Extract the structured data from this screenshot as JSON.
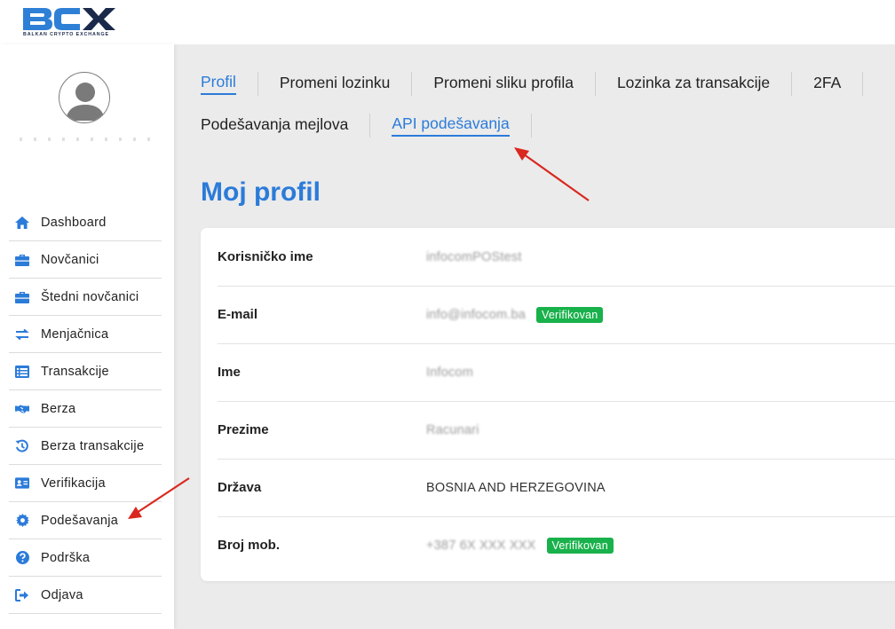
{
  "logo": {
    "text": "BCX",
    "tagline": "BALKAN CRYPTO EXCHANGE"
  },
  "colors": {
    "accent": "#2b7bd9",
    "verified": "#19b14b",
    "annotation": "#d9281f"
  },
  "sidebar": {
    "items": [
      {
        "label": "Dashboard",
        "icon": "home-icon"
      },
      {
        "label": "Novčanici",
        "icon": "briefcase-icon"
      },
      {
        "label": "Štedni novčanici",
        "icon": "briefcase-icon"
      },
      {
        "label": "Menjačnica",
        "icon": "exchange-icon"
      },
      {
        "label": "Transakcije",
        "icon": "list-icon"
      },
      {
        "label": "Berza",
        "icon": "handshake-icon"
      },
      {
        "label": "Berza transakcije",
        "icon": "history-icon"
      },
      {
        "label": "Verifikacija",
        "icon": "id-card-icon"
      },
      {
        "label": "Podešavanja",
        "icon": "gear-icon"
      },
      {
        "label": "Podrška",
        "icon": "question-icon"
      },
      {
        "label": "Odjava",
        "icon": "sign-out-icon"
      }
    ]
  },
  "tabs": {
    "profil": "Profil",
    "promeni_lozinku": "Promeni lozinku",
    "promeni_sliku": "Promeni sliku profila",
    "lozinka_transakcije": "Lozinka za transakcije",
    "twofa": "2FA",
    "podesavanja_mejlova": "Podešavanja mejlova",
    "api_podesavanja": "API podešavanja"
  },
  "page_title": "Moj profil",
  "profile": {
    "korisnicko_ime": {
      "label": "Korisničko ime",
      "value": "infocomPOStest"
    },
    "email": {
      "label": "E-mail",
      "value": "info@infocom.ba",
      "badge": "Verifikovan"
    },
    "ime": {
      "label": "Ime",
      "value": "Infocom"
    },
    "prezime": {
      "label": "Prezime",
      "value": "Racunari"
    },
    "drzava": {
      "label": "Država",
      "value": "BOSNIA AND HERZEGOVINA"
    },
    "broj_mob": {
      "label": "Broj mob.",
      "value": "+387 6X XXX XXX",
      "badge": "Verifikovan"
    }
  }
}
